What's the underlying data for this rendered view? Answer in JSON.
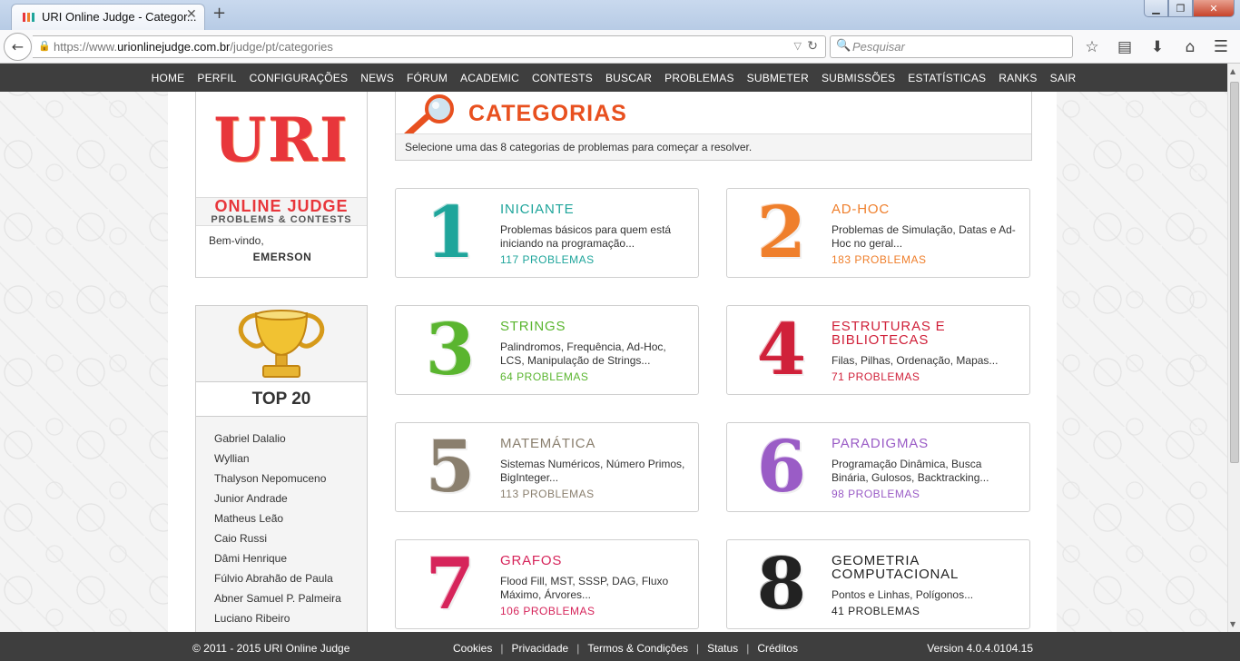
{
  "browser": {
    "tab_title": "URI Online Judge - Categor...",
    "tab_close": "✕",
    "new_tab": "+",
    "url_prefix": "https://www.",
    "url_domain": "urionlinejudge.com.br",
    "url_path": "/judge/pt/categories",
    "search_placeholder": "Pesquisar",
    "window_buttons": {
      "minimize": "▁",
      "maximize": "❐",
      "close": "✕"
    }
  },
  "menu": [
    "HOME",
    "PERFIL",
    "CONFIGURAÇÕES",
    "NEWS",
    "FÓRUM",
    "ACADEMIC",
    "CONTESTS",
    "BUSCAR",
    "PROBLEMAS",
    "SUBMETER",
    "SUBMISSÕES",
    "ESTATÍSTICAS",
    "RANKS",
    "SAIR"
  ],
  "logo": {
    "uri": "URI",
    "online_judge": "ONLINE JUDGE",
    "tagline": "PROBLEMS & CONTESTS"
  },
  "user": {
    "welcome": "Bem-vindo,",
    "name": "EMERSON"
  },
  "top20": {
    "title": "TOP 20",
    "names": [
      "Gabriel Dalalio",
      "Wyllian",
      "Thalyson Nepomuceno",
      "Junior Andrade",
      "Matheus Leão",
      "Caio Russi",
      "Dâmi Henrique",
      "Fúlvio Abrahão de Paula",
      "Abner Samuel P. Palmeira",
      "Luciano Ribeiro"
    ]
  },
  "header": {
    "title": "CATEGORIAS",
    "subtitle": "Selecione uma das 8 categorias de problemas para começar a resolver."
  },
  "categories": [
    {
      "num": "1",
      "title": "INICIANTE",
      "desc": "Problemas básicos para quem está iniciando na programação...",
      "count": "117 PROBLEMAS",
      "color": "#1fa59b"
    },
    {
      "num": "2",
      "title": "AD-HOC",
      "desc": "Problemas de Simulação, Datas e Ad-Hoc no geral...",
      "count": "183 PROBLEMAS",
      "color": "#ef7f2c"
    },
    {
      "num": "3",
      "title": "STRINGS",
      "desc": "Palindromos, Frequência, Ad-Hoc, LCS, Manipulação de Strings...",
      "count": "64 PROBLEMAS",
      "color": "#5ab52f"
    },
    {
      "num": "4",
      "title": "ESTRUTURAS E BIBLIOTECAS",
      "desc": "Filas, Pilhas, Ordenação, Mapas...",
      "count": "71 PROBLEMAS",
      "color": "#d0213a"
    },
    {
      "num": "5",
      "title": "MATEMÁTICA",
      "desc": "Sistemas Numéricos, Número Primos, BigInteger...",
      "count": "113 PROBLEMAS",
      "color": "#8a7f6e"
    },
    {
      "num": "6",
      "title": "PARADIGMAS",
      "desc": "Programação Dinâmica, Busca Binária, Gulosos, Backtracking...",
      "count": "98 PROBLEMAS",
      "color": "#9a5cc6"
    },
    {
      "num": "7",
      "title": "GRAFOS",
      "desc": "Flood Fill, MST, SSSP, DAG, Fluxo Máximo, Árvores...",
      "count": "106 PROBLEMAS",
      "color": "#d6245a"
    },
    {
      "num": "8",
      "title": "GEOMETRIA COMPUTACIONAL",
      "desc": "Pontos e Linhas, Polígonos...",
      "count": "41 PROBLEMAS",
      "color": "#222222"
    }
  ],
  "footer": {
    "copyright": "© 2011 - 2015 URI Online Judge",
    "links": [
      "Cookies",
      "Privacidade",
      "Termos & Condições",
      "Status",
      "Créditos"
    ],
    "separator": "|",
    "version": "Version 4.0.4.0104.15"
  }
}
